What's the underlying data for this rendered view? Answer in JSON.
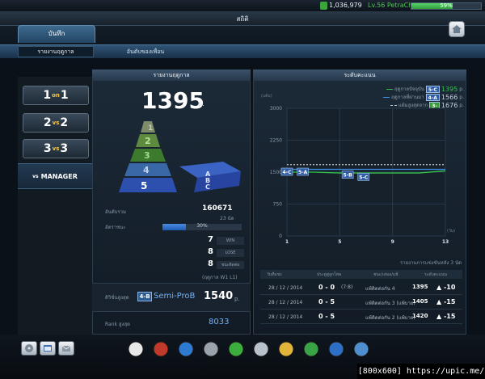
{
  "status": {
    "money": "1,036,979",
    "level": "Lv.56 PetraChelseaFC",
    "xp_percent": 59,
    "xp_label": "59%"
  },
  "window": {
    "title": "สถิติ"
  },
  "tabs": {
    "main": "บันทึก"
  },
  "subtabs": [
    "รายงานฤดูกาล",
    "อันดับของเพื่อน"
  ],
  "modes": [
    {
      "left": "1",
      "mid": "on",
      "right": "1"
    },
    {
      "left": "2",
      "mid": "vs",
      "right": "2"
    },
    {
      "left": "3",
      "mid": "vs",
      "right": "3"
    },
    {
      "prefix": "vs",
      "label": "MANAGER"
    }
  ],
  "season": {
    "header": "รายงานฤดูกาล",
    "points": "1395",
    "points_unit": "p.",
    "pyramid_tiers": [
      "1",
      "2",
      "3",
      "4",
      "5"
    ],
    "pyramid_side": [
      "A",
      "B",
      "C"
    ],
    "rank_label": "อันดับรวม",
    "rank_value": "160671",
    "rank_sub": "23 นัด",
    "winrate_label": "อัตราชนะ",
    "winrate_percent": 30,
    "winrate_text": "30%",
    "wins": "7",
    "win_tag": "WIN",
    "losses": "8",
    "lose_tag": "LOSE",
    "draws": "8",
    "draw_tag": "ชนะติดต่อ",
    "streak_note": "(ฤดูกาล W1 L1)",
    "best_div_label": "ดิวิชั่นสูงสุด",
    "best_div_badge": "4-B",
    "best_div_name": "Semi-ProB",
    "best_div_points": "1540",
    "best_div_unit": "p.",
    "best_rank_label": "Rank สูงสุด",
    "best_rank_value": "8033"
  },
  "chart_data": {
    "type": "line",
    "title": "ระดับคะแนน",
    "ylabel": "(แต้ม)",
    "xlabel": "(วัน)",
    "ylim": [
      0,
      3000
    ],
    "xlim": [
      1,
      13
    ],
    "yticks": [
      "3000",
      "2250",
      "1500",
      "750",
      "0"
    ],
    "xticks": [
      "1",
      "5",
      "9",
      "13"
    ],
    "grid": true,
    "legend_position": "top-right",
    "series": [
      {
        "name": "ฤดูกาลปัจจุบัน",
        "badge": "5-C",
        "value": "1395",
        "unit": "p.",
        "color": "#35c24a",
        "x": [
          1,
          3,
          5,
          7,
          9,
          11,
          13
        ],
        "y": [
          1500,
          1500,
          1480,
          1480,
          1480,
          1480,
          1530
        ]
      },
      {
        "name": "ฤดูกาลที่ผ่านมา",
        "badge": "4-A",
        "value": "1566",
        "unit": "p.",
        "color": "#3f8ee8",
        "x": [
          1,
          3,
          5,
          7,
          9,
          11,
          13
        ],
        "y": [
          1565,
          1565,
          1566,
          1566,
          1566,
          1566,
          1566
        ]
      },
      {
        "name": "แต้มสูงสุดจาก",
        "badge": "3-",
        "value": "1676",
        "unit": "p.",
        "color": "#c9c9c9",
        "x": [
          1,
          13
        ],
        "y": [
          1676,
          1676
        ]
      }
    ],
    "point_badges": [
      {
        "label": "4-C",
        "x": 1,
        "y": 1500
      },
      {
        "label": "5-A",
        "x": 2.2,
        "y": 1500
      },
      {
        "label": "5-B",
        "x": 5.6,
        "y": 1430
      },
      {
        "label": "5-C",
        "x": 6.8,
        "y": 1380
      }
    ]
  },
  "history": {
    "title": "รายงานการแข่งขันหลัง 3 นัด",
    "headers": [
      "วันที่แข่ง",
      "ประตูสู่ลูกโทษ",
      "ชนะ/เสมอ/แพ้",
      "ระดับคะแนน"
    ],
    "rows": [
      {
        "date": "28 / 12 / 2014",
        "score": "0 - 0",
        "extra": "(7:8)",
        "result": "แพ้ติดต่อกัน 4",
        "points": "1395",
        "delta": "-10"
      },
      {
        "date": "28 / 12 / 2014",
        "score": "0 - 5",
        "extra": "",
        "result": "แพ้ติดต่อกัน 3 (แพ้บาย)",
        "points": "1405",
        "delta": "-15"
      },
      {
        "date": "28 / 12 / 2014",
        "score": "0 - 5",
        "extra": "",
        "result": "แพ้ติดต่อกัน 2 (แพ้บาย)",
        "points": "1420",
        "delta": "-15"
      }
    ]
  },
  "dock_icons": [
    "ball-icon",
    "whistle-icon",
    "boot-icon",
    "trophy-icon",
    "pyramid-icon",
    "cards-icon",
    "badge-icon",
    "club-icon",
    "pen-icon",
    "cart-icon"
  ],
  "watermark": "[800x600] https://upic.me/"
}
